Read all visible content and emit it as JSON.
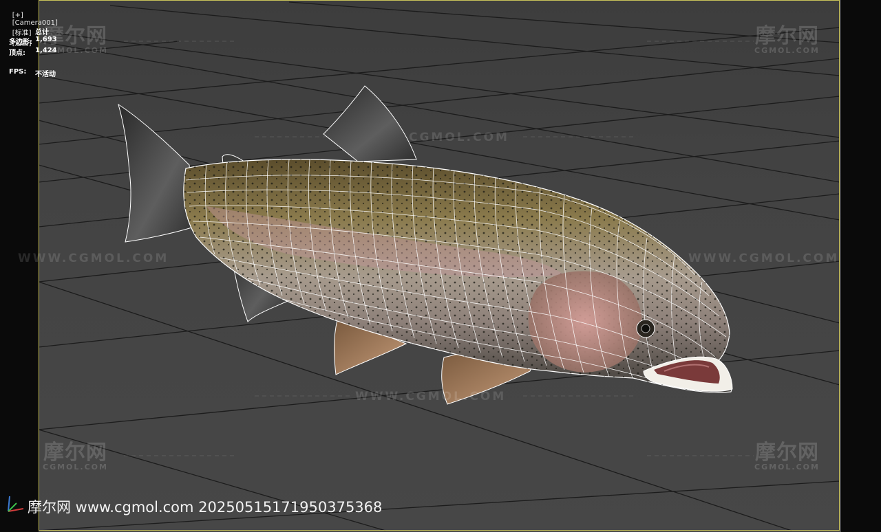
{
  "viewport_label": {
    "plus": "[+]",
    "camera": "[Camera001]",
    "shading": "[标准]",
    "display": "[边面]"
  },
  "stats": {
    "title": "总计",
    "polygons_label": "多边形:",
    "polygons_value": "1,693",
    "vertices_label": "顶点:",
    "vertices_value": "1,424",
    "fps_label": "FPS:",
    "fps_value": "不活动"
  },
  "watermark": {
    "logo_text": "摩尔网",
    "logo_sub": "CGMOL.COM",
    "line_text": "WWW.CGMOL.COM",
    "center_text": "CGMOL.COM"
  },
  "footer": {
    "text": "摩尔网 www.cgmol.com 20250515171950375368"
  },
  "colors": {
    "frame": "#c9c25a",
    "grid": "#1b1b1b",
    "wire": "#ffffff",
    "fish_back": "#6a5a35",
    "fish_belly": "#b7a7a0",
    "gill": "#c38a86"
  },
  "scene": {
    "object": "trout-model",
    "grid_visible": true,
    "wireframe_on_shaded": true
  }
}
